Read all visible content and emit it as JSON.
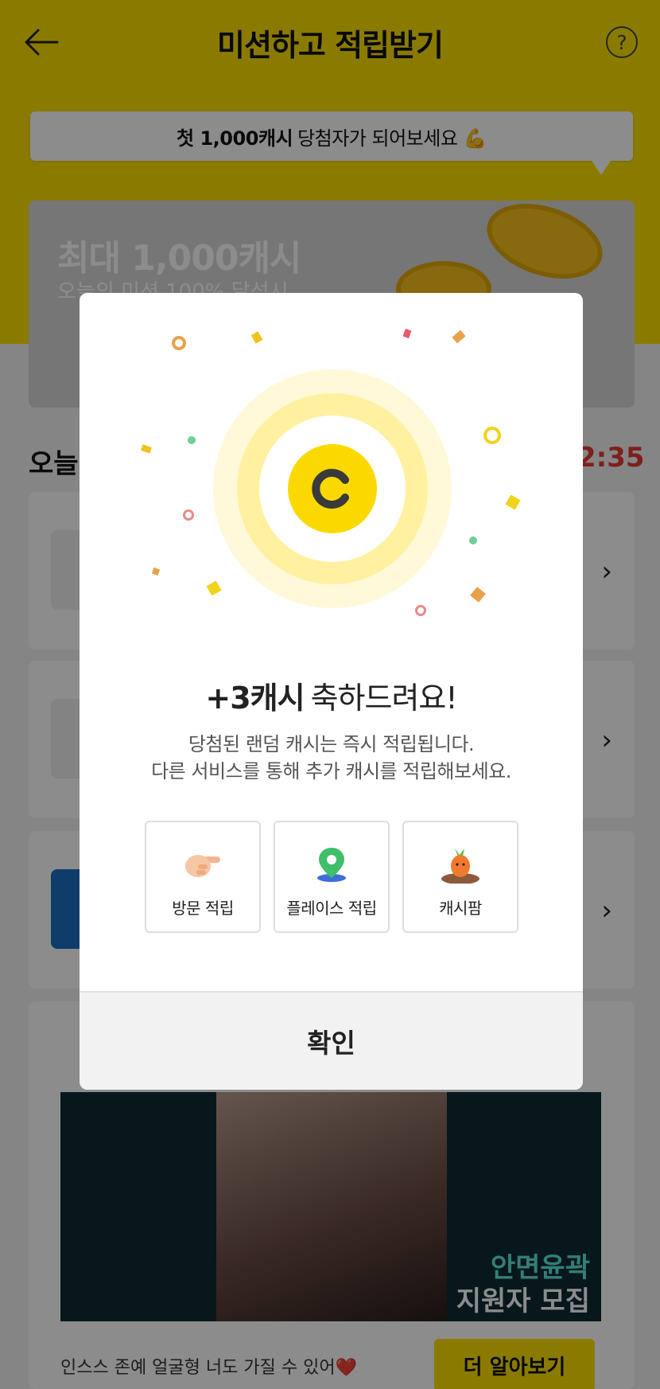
{
  "header": {
    "title": "미션하고 적립받기",
    "help_glyph": "?"
  },
  "promo": {
    "bold": "첫 1,000캐시",
    "text": "당첨자가 되어보세요 💪"
  },
  "hero": {
    "title": "최대 1,000캐시",
    "subtitle": "오늘의 미션 100% 달성시"
  },
  "section": {
    "title": "오늘",
    "timer": "2:35"
  },
  "ad": {
    "headline_line1": "안면윤곽",
    "headline_line2": "지원자 모집",
    "caption": "인스스 존예 얼굴형 너도 가질 수 있어❤️",
    "cta": "더 알아보기"
  },
  "modal": {
    "title_bold": "+3캐시",
    "title_rest": "축하드려요!",
    "desc_line1": "당첨된 랜덤 캐시는 즉시 적립됩니다.",
    "desc_line2": "다른 서비스를 통해 추가 캐시를 적립해보세요.",
    "options": [
      {
        "label": "방문 적립",
        "icon": "pointing-hand-icon"
      },
      {
        "label": "플레이스 적립",
        "icon": "map-pin-icon"
      },
      {
        "label": "캐시팜",
        "icon": "carrot-icon"
      }
    ],
    "confirm": "확인"
  },
  "colors": {
    "brand_yellow": "#fbe000",
    "timer_red": "#e53935",
    "coin_yellow": "#fbd900"
  }
}
